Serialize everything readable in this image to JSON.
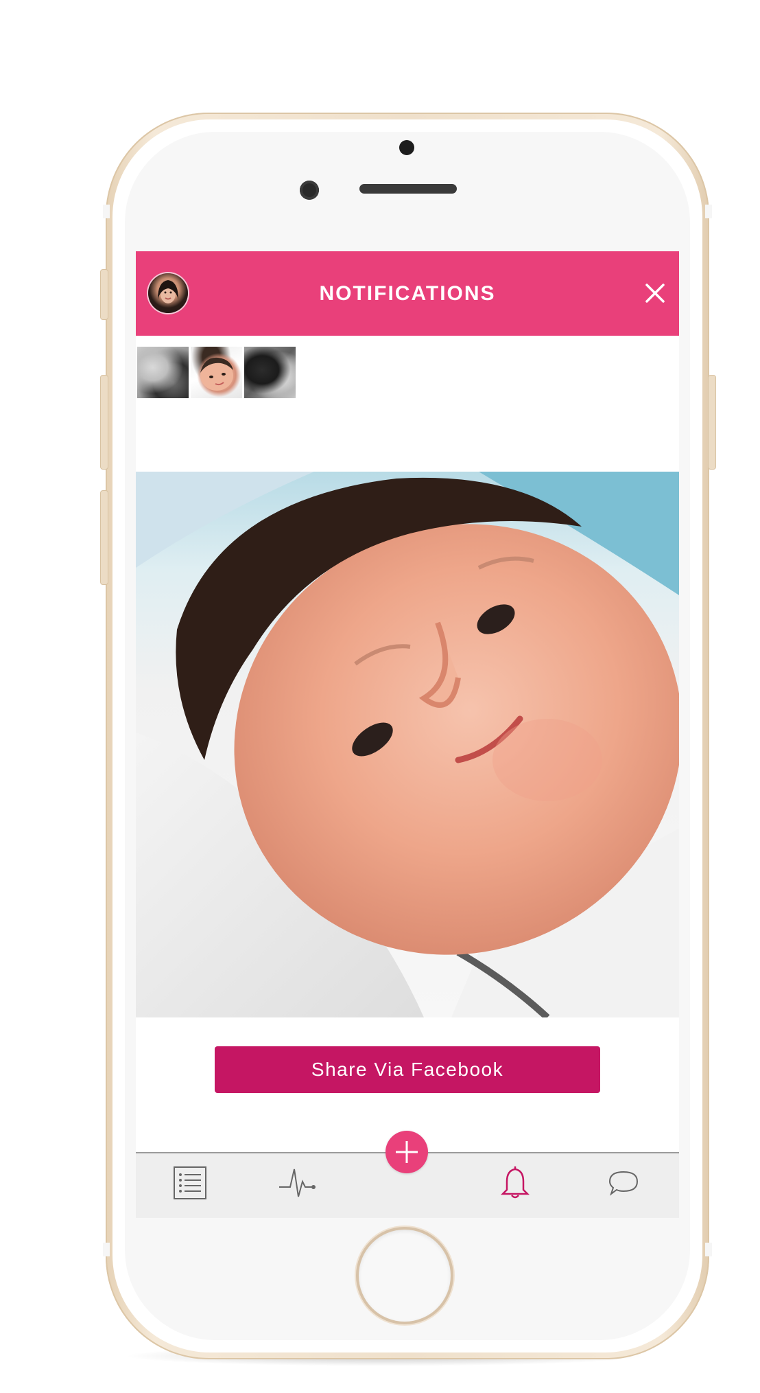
{
  "header": {
    "title": "NOTIFICATIONS",
    "avatar_icon": "user-avatar",
    "close_icon": "close-icon",
    "background_color": "#e9407a"
  },
  "thumbnails": [
    {
      "name": "thumbnail-1",
      "tone": "grayscale"
    },
    {
      "name": "thumbnail-2",
      "tone": "color",
      "selected": true
    },
    {
      "name": "thumbnail-3",
      "tone": "grayscale"
    }
  ],
  "main_photo": {
    "subject": "baby-photo"
  },
  "share_button": {
    "label": "Share Via Facebook",
    "color": "#c51663"
  },
  "tabbar": {
    "items": [
      {
        "icon": "list-icon",
        "active": false
      },
      {
        "icon": "activity-icon",
        "active": false
      },
      {
        "icon": "plus-icon",
        "active": false,
        "floating": true
      },
      {
        "icon": "bell-icon",
        "active": true
      },
      {
        "icon": "chat-bubble-icon",
        "active": false
      }
    ],
    "active_color": "#c51663",
    "inactive_color": "#666666"
  }
}
